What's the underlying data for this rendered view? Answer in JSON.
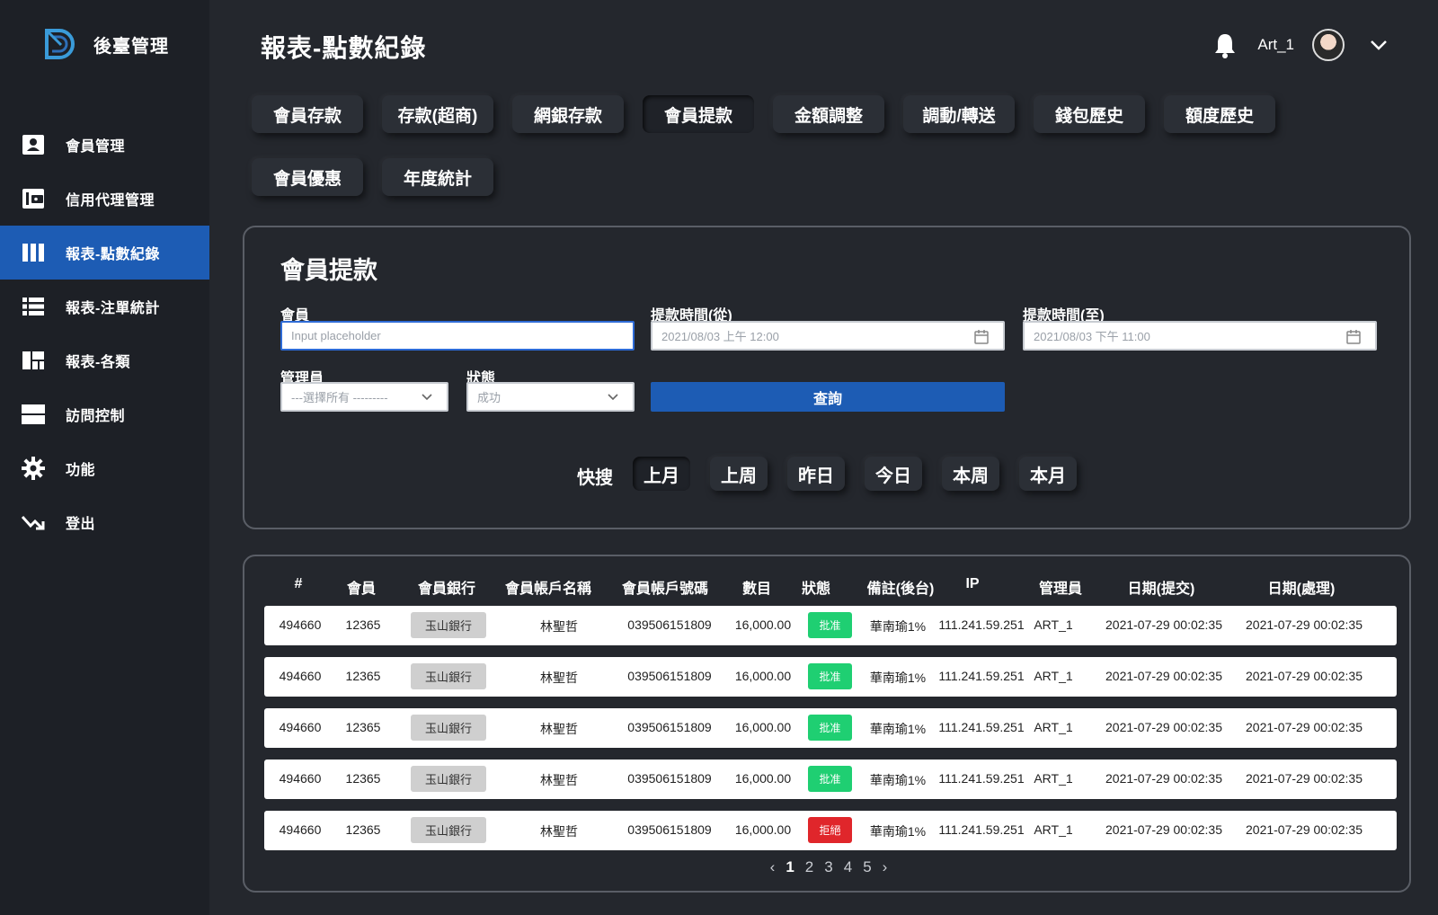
{
  "brand": {
    "title": "後臺管理"
  },
  "sidebar": {
    "items": [
      {
        "label": "會員管理",
        "icon": "user-card-icon",
        "active": false
      },
      {
        "label": "信用代理管理",
        "icon": "wallet-icon",
        "active": false
      },
      {
        "label": "報表-點數紀錄",
        "icon": "columns-icon",
        "active": true
      },
      {
        "label": "報表-注單統計",
        "icon": "list-icon",
        "active": false
      },
      {
        "label": "報表-各類",
        "icon": "dashboard-icon",
        "active": false
      },
      {
        "label": "訪問控制",
        "icon": "server-icon",
        "active": false
      },
      {
        "label": "功能",
        "icon": "gear-icon",
        "active": false
      },
      {
        "label": "登出",
        "icon": "logout-icon",
        "active": false
      }
    ]
  },
  "header": {
    "title": "報表-點數紀錄",
    "username": "Art_1"
  },
  "tabs": [
    "會員存款",
    "存款(超商)",
    "網銀存款",
    "會員提款",
    "金額調整",
    "調動/轉送",
    "錢包歷史",
    "額度歷史",
    "會員優惠",
    "年度統計"
  ],
  "active_tab": "會員提款",
  "filter": {
    "title": "會員提款",
    "member_label": "會員",
    "member_placeholder": "Input placeholder",
    "from_label": "提款時間(從)",
    "from_value": "2021/08/03 上午 12:00",
    "to_label": "提款時間(至)",
    "to_value": "2021/08/03 下午 11:00",
    "admin_label": "管理員",
    "admin_value": "---選擇所有 ---------",
    "status_label": "狀態",
    "status_value": "成功",
    "query_label": "查詢",
    "quick_label": "快搜",
    "quick": [
      "上月",
      "上周",
      "昨日",
      "今日",
      "本周",
      "本月"
    ]
  },
  "table": {
    "columns": [
      "#",
      "會員",
      "會員銀行",
      "會員帳戶名稱",
      "會員帳戶號碼",
      "數目",
      "狀態",
      "備註(後台)",
      "IP",
      "管理員",
      "日期(提交)",
      "日期(處理)"
    ],
    "rows": [
      {
        "id": "494660",
        "member": "12365",
        "bank": "玉山銀行",
        "acct_name": "林聖哲",
        "acct_no": "039506151809",
        "amount": "16,000.00",
        "status": "批准",
        "note": "華南瑜1%",
        "ip": "111.241.59.251",
        "admin": "ART_1",
        "submitted": "2021-07-29 00:02:35",
        "processed": "2021-07-29 00:02:35"
      },
      {
        "id": "494660",
        "member": "12365",
        "bank": "玉山銀行",
        "acct_name": "林聖哲",
        "acct_no": "039506151809",
        "amount": "16,000.00",
        "status": "批准",
        "note": "華南瑜1%",
        "ip": "111.241.59.251",
        "admin": "ART_1",
        "submitted": "2021-07-29 00:02:35",
        "processed": "2021-07-29 00:02:35"
      },
      {
        "id": "494660",
        "member": "12365",
        "bank": "玉山銀行",
        "acct_name": "林聖哲",
        "acct_no": "039506151809",
        "amount": "16,000.00",
        "status": "批准",
        "note": "華南瑜1%",
        "ip": "111.241.59.251",
        "admin": "ART_1",
        "submitted": "2021-07-29 00:02:35",
        "processed": "2021-07-29 00:02:35"
      },
      {
        "id": "494660",
        "member": "12365",
        "bank": "玉山銀行",
        "acct_name": "林聖哲",
        "acct_no": "039506151809",
        "amount": "16,000.00",
        "status": "批准",
        "note": "華南瑜1%",
        "ip": "111.241.59.251",
        "admin": "ART_1",
        "submitted": "2021-07-29 00:02:35",
        "processed": "2021-07-29 00:02:35"
      },
      {
        "id": "494660",
        "member": "12365",
        "bank": "玉山銀行",
        "acct_name": "林聖哲",
        "acct_no": "039506151809",
        "amount": "16,000.00",
        "status": "拒絕",
        "note": "華南瑜1%",
        "ip": "111.241.59.251",
        "admin": "ART_1",
        "submitted": "2021-07-29 00:02:35",
        "processed": "2021-07-29 00:02:35"
      }
    ]
  },
  "status_colors": {
    "批准": "#1fcf72",
    "拒絕": "#e0262b"
  },
  "colors": {
    "accent": "#1d5cb4",
    "sidebar_bg": "#1d2026",
    "page_bg": "#24272d"
  },
  "pagination": {
    "prev": "‹",
    "next": "›",
    "pages": [
      "1",
      "2",
      "3",
      "4",
      "5"
    ],
    "current": "1"
  }
}
